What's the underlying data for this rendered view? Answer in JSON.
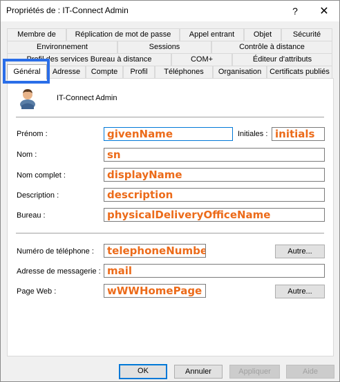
{
  "window": {
    "title": "Propriétés de : IT-Connect Admin",
    "help_label": "?",
    "close_label": "✕"
  },
  "tabs": {
    "row1": [
      "Membre de",
      "Réplication de mot de passe",
      "Appel entrant",
      "Objet",
      "Sécurité"
    ],
    "row2": [
      "Environnement",
      "Sessions",
      "Contrôle à distance"
    ],
    "row3": [
      "Profil des services Bureau à distance",
      "COM+",
      "Éditeur d'attributs"
    ],
    "row4": [
      "Général",
      "Adresse",
      "Compte",
      "Profil",
      "Téléphones",
      "Organisation",
      "Certificats publiés"
    ],
    "active": "Général"
  },
  "user": {
    "name": "IT-Connect Admin",
    "icon": "user-icon"
  },
  "form": {
    "prenom_label": "Prénom :",
    "prenom_value": "givenName",
    "initiales_label": "Initiales :",
    "initiales_value": "initials",
    "nom_label": "Nom :",
    "nom_value": "sn",
    "nom_complet_label": "Nom complet :",
    "nom_complet_value": "displayName",
    "description_label": "Description :",
    "description_value": "description",
    "bureau_label": "Bureau :",
    "bureau_value": "physicalDeliveryOfficeName",
    "telephone_label": "Numéro de téléphone :",
    "telephone_value": "telephoneNumber",
    "autre_label": "Autre...",
    "mail_label": "Adresse de messagerie :",
    "mail_value": "mail",
    "web_label": "Page Web :",
    "web_value": "wWWHomePage"
  },
  "footer": {
    "ok": "OK",
    "cancel": "Annuler",
    "apply": "Appliquer",
    "help": "Aide"
  },
  "colors": {
    "field_text": "#ec6b1a",
    "highlight": "#2a6ee8",
    "focus": "#0078d7"
  }
}
